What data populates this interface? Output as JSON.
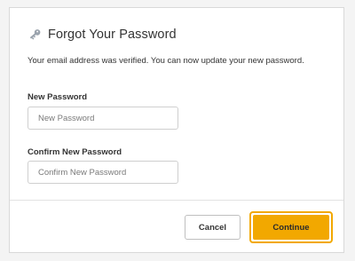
{
  "dialog": {
    "title": "Forgot Your Password",
    "title_icon": "key-icon",
    "message": "Your email address was verified. You can now update your new password."
  },
  "form": {
    "new_password": {
      "label": "New Password",
      "placeholder": "New Password",
      "value": ""
    },
    "confirm_password": {
      "label": "Confirm New Password",
      "placeholder": "Confirm New Password",
      "value": ""
    }
  },
  "actions": {
    "cancel_label": "Cancel",
    "continue_label": "Continue"
  },
  "colors": {
    "accent": "#f2a800",
    "text": "#333333",
    "border": "#cfcfcf",
    "icon": "#9aa3ad"
  }
}
